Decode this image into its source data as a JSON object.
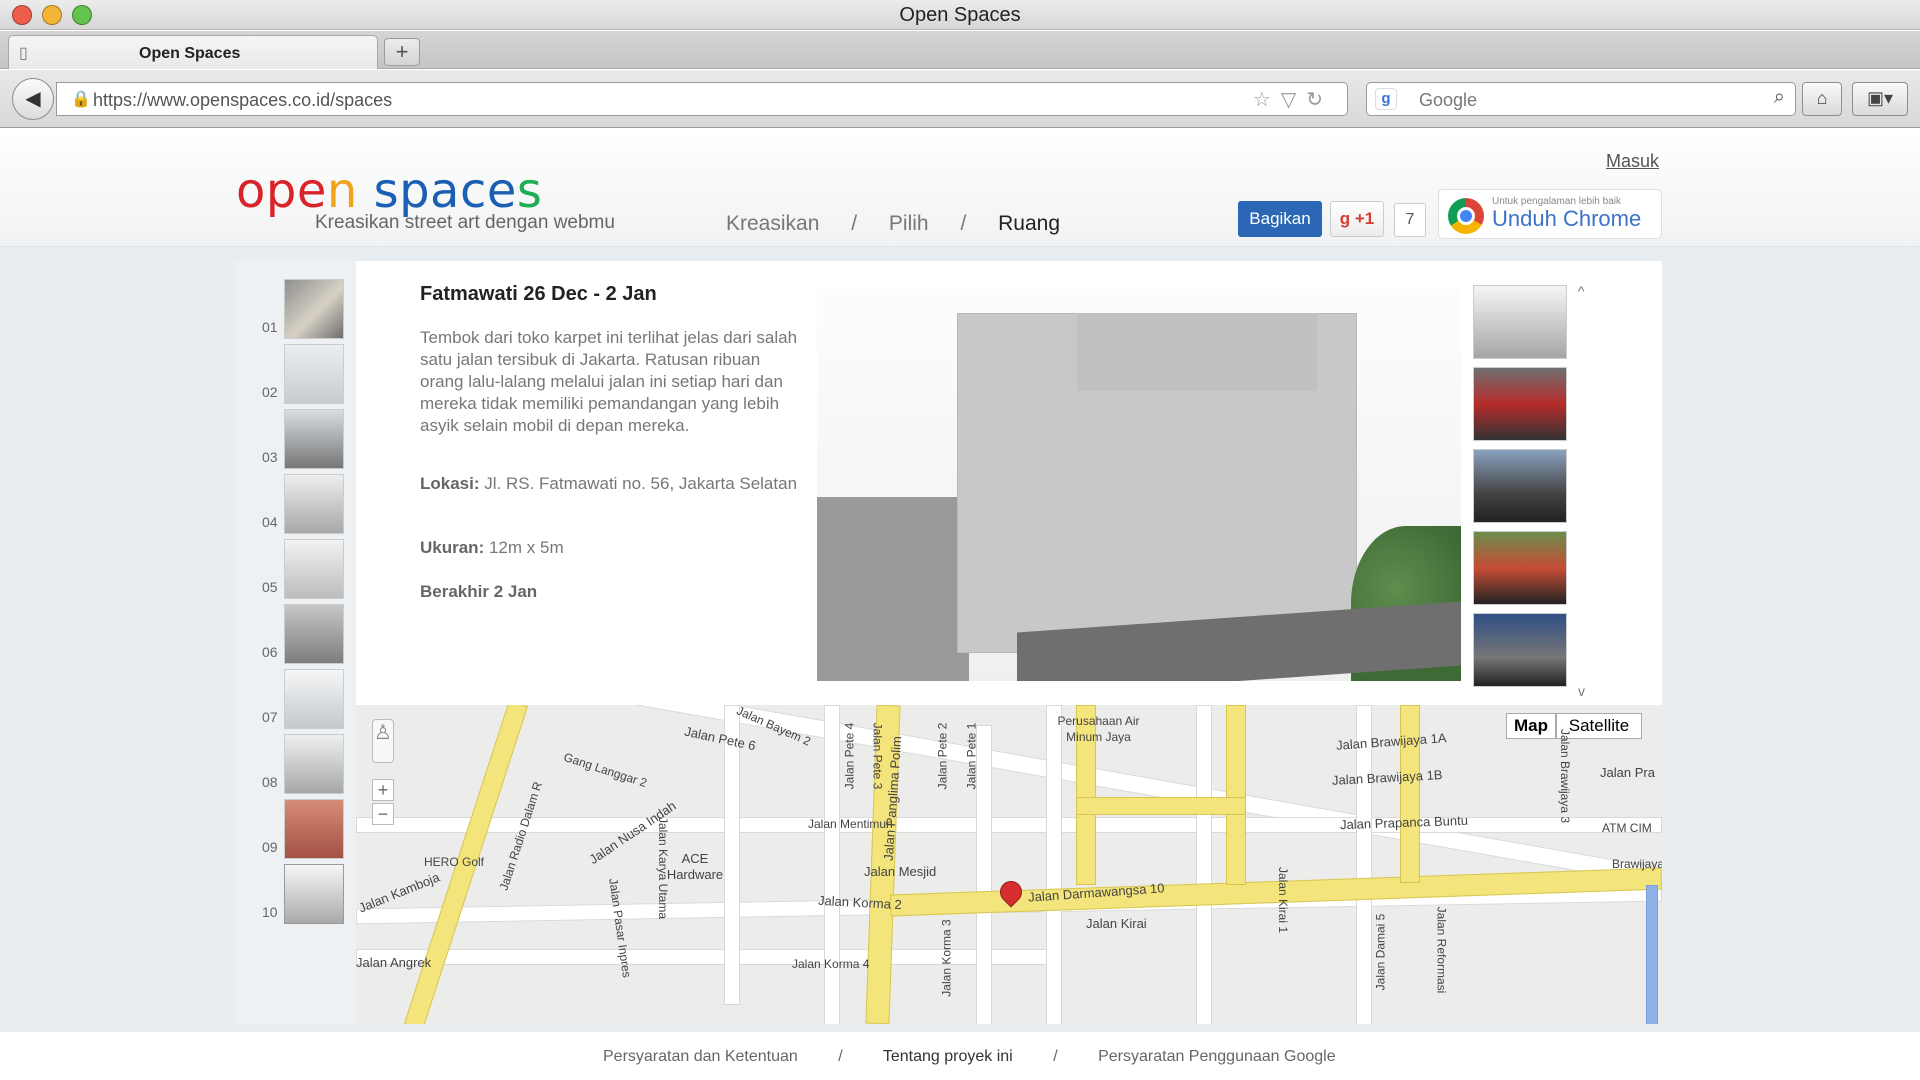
{
  "window": {
    "title": "Open Spaces"
  },
  "tabs": [
    {
      "label": "Open Spaces"
    }
  ],
  "toolbar": {
    "url": "https://www.openspaces.co.id/spaces",
    "search_placeholder": "Google"
  },
  "site": {
    "logo_parts": {
      "p1": "o",
      "p2": "p",
      "p3": "e",
      "p4": "n",
      "p5": " ",
      "p6": "s",
      "p7": "p",
      "p8": "a",
      "p9": "c",
      "p10": "e",
      "p11": "s"
    },
    "tagline": "Kreasikan street art dengan webmu",
    "login": "Masuk",
    "nav": [
      "Kreasikan",
      "/",
      "Pilih",
      "/",
      "Ruang"
    ],
    "share_button": "Bagikan",
    "gplus": "+1",
    "count": "7",
    "chrome_small": "Untuk pengalaman lebih baik",
    "chrome_big": "Unduh Chrome"
  },
  "spaces": [
    {
      "num": "01"
    },
    {
      "num": "02"
    },
    {
      "num": "03"
    },
    {
      "num": "04"
    },
    {
      "num": "05"
    },
    {
      "num": "06"
    },
    {
      "num": "07"
    },
    {
      "num": "08"
    },
    {
      "num": "09"
    },
    {
      "num": "10"
    }
  ],
  "detail": {
    "title": "Fatmawati 26 Dec - 2 Jan",
    "description": "Tembok dari toko karpet ini terlihat jelas dari salah satu jalan tersibuk di Jakarta. Ratusan ribuan orang lalu-lalang melalui jalan ini setiap hari dan mereka tidak memiliki pemandangan yang lebih asyik selain mobil di depan mereka.",
    "location_label": "Lokasi:",
    "location_value": "Jl. RS. Fatmawati no. 56, Jakarta Selatan",
    "size_label": "Ukuran:",
    "size_value": "12m x 5m",
    "ends": "Berakhir 2 Jan",
    "up": "^",
    "down": "v"
  },
  "map": {
    "map_button": "Map",
    "satellite_button": "Satellite",
    "labels": [
      "Jalan Radio Dalam R",
      "Jalan Pete 6",
      "Gang Langgar 2",
      "Jalan Bayem 2",
      "Jalan Pete 4",
      "Jalan Pete 3",
      "Jalan Pete 2",
      "Jalan Pete 1",
      "Perusahaan Air Minum Jaya",
      "Jalan Brawijaya 1A",
      "Jalan Brawijaya 1B",
      "Jalan Brawijaya 3",
      "Jalan Pra",
      "Jalan Mentimun",
      "ACE Hardware",
      "Jalan Nusa Indah",
      "Jalan Panglima Polim",
      "Jalan Prapanca Buntu",
      "ATM CIM",
      "Jalan Mesjid",
      "Jalan Darmawangsa 10",
      "Jalan Kirai 1",
      "Jalan Korma 2",
      "Jalan Korma 3",
      "Jalan Kirai",
      "Jalan Damai 5",
      "Jalan Reformasi",
      "Jalan Kamboja",
      "HERO Golf",
      "Jalan Angrek",
      "Jalan Karya Utama",
      "Jalan Korma 4",
      "Jalan Pasar Inpres",
      "Brawijaya"
    ]
  },
  "footer": {
    "links": [
      "Persyaratan dan Ketentuan",
      "Tentang proyek ini",
      "Persyaratan Penggunaan Google"
    ],
    "separator": "/"
  },
  "colors": {
    "logo_red": "#d9232a",
    "logo_orange": "#f0a31b",
    "logo_blue": "#1a5fb4",
    "logo_green": "#1fae54",
    "share_blue": "#2a67b5"
  }
}
